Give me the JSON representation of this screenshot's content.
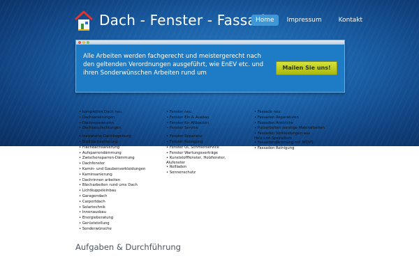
{
  "header": {
    "title": "Dach - Fenster - Fassade",
    "nav": [
      {
        "label": "Home",
        "active": true
      },
      {
        "label": "Impressum",
        "active": false
      },
      {
        "label": "Kontakt",
        "active": false
      }
    ]
  },
  "banner": {
    "text": "Alle Arbeiten werden fachgerecht und meistergerecht nach den geltenden Verordnungen ausgeführt, wie EnEV etc. und ihren Sonderwünschen Arbeiten rund um",
    "button": "Mailen Sie uns!"
  },
  "services": {
    "dach": [
      "komplettes Dach neu",
      "Dachsanierungen",
      "Dachreparaturen",
      "Dachbeschichtungen",
      "",
      "Instrafalne Dachbegehung",
      "Steildachsanierung",
      "Flachdachsanierung",
      "Aufsparrendämmung",
      "Zwischensparren-Dämmung",
      "Dachfenster",
      "Kamin- und Gaubenverkleidungen",
      "Kaminsanierung",
      "Dachrinnen arbeiten",
      "Blecharbeiten rund ums Dach",
      "Lichtkuppeleinbau",
      "Garagendach",
      "Carportdach",
      "Solartechnik",
      "Innenausbau",
      "Energieberatung",
      "Gerüststellung",
      "Sonderwünsche"
    ],
    "fenster": [
      "Fenster neu",
      "Fenster Ein & Ausbau",
      "Fenster für Altbauten",
      "Fenster Service",
      "",
      "Fenster Reparatur",
      "Fenster Reinigung",
      "Fenster Öl, Schmierservice",
      "Fenster Wartungsverträge",
      "Kunststofffenster, Holzfenster, Alufenster",
      "Rollladen",
      "Sonnenschutz"
    ],
    "fassade": [
      "Fassade neu",
      "Fassaden Reparaturen",
      "Fassaden Anstriche",
      "Putzarbeiten sonstige Malerarbeiten",
      "Fassaden Verkleidungen aus Holz und Speziellem",
      "Fassadendämmung mit WDVS",
      "Fassaden Reinigung"
    ]
  },
  "section": {
    "heading": "Aufgaben & Durchführung"
  },
  "colors": {
    "hero_dark": "#0f3f7c",
    "hero_light": "#2a7fc6",
    "banner": "#1e7cc7",
    "nav_active": "#3f97d8",
    "button": "#c4d22a"
  },
  "icons": {
    "logo": "house-logo-icon"
  }
}
